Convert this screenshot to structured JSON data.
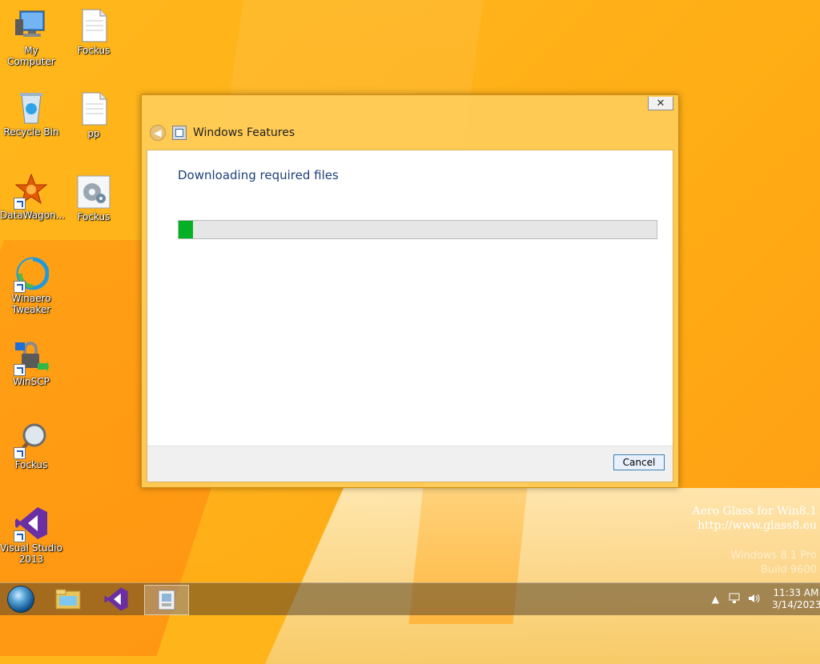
{
  "desktop_icons": [
    {
      "label": "My Computer",
      "icon": "computer-icon"
    },
    {
      "label": "Fockus",
      "icon": "document-icon"
    },
    {
      "label": "Recycle Bin",
      "icon": "recycle-bin-icon"
    },
    {
      "label": "pp",
      "icon": "document-icon"
    },
    {
      "label": "DataWagon...",
      "icon": "datawagon-icon"
    },
    {
      "label": "Fockus",
      "icon": "settings-gear-icon"
    },
    {
      "label": "Winaero Tweaker",
      "icon": "winaero-tweaker-icon"
    },
    {
      "label": "WinSCP",
      "icon": "winscp-icon"
    },
    {
      "label": "Fockus",
      "icon": "magnifier-icon"
    },
    {
      "label": "Visual Studio 2013",
      "icon": "visual-studio-icon"
    }
  ],
  "dialog": {
    "title": "Windows Features",
    "heading": "Downloading required files",
    "progress_fraction": 0.03,
    "cancel_label": "Cancel",
    "close_label": "✕"
  },
  "watermark": {
    "line1": "Aero Glass for Win8.1",
    "line2": "http://www.glass8.eu",
    "line3": "Windows 8.1 Pro",
    "line4": "Build 9600"
  },
  "taskbar": {
    "items": [
      "start-orb-icon",
      "file-explorer-icon",
      "visual-studio-icon",
      "windows-features-icon"
    ],
    "active_item": "windows-features-icon",
    "time": "11:33 AM",
    "date": "3/14/2023"
  },
  "colors": {
    "progress_green": "#06b025",
    "heading_blue": "#1e3f7a"
  }
}
